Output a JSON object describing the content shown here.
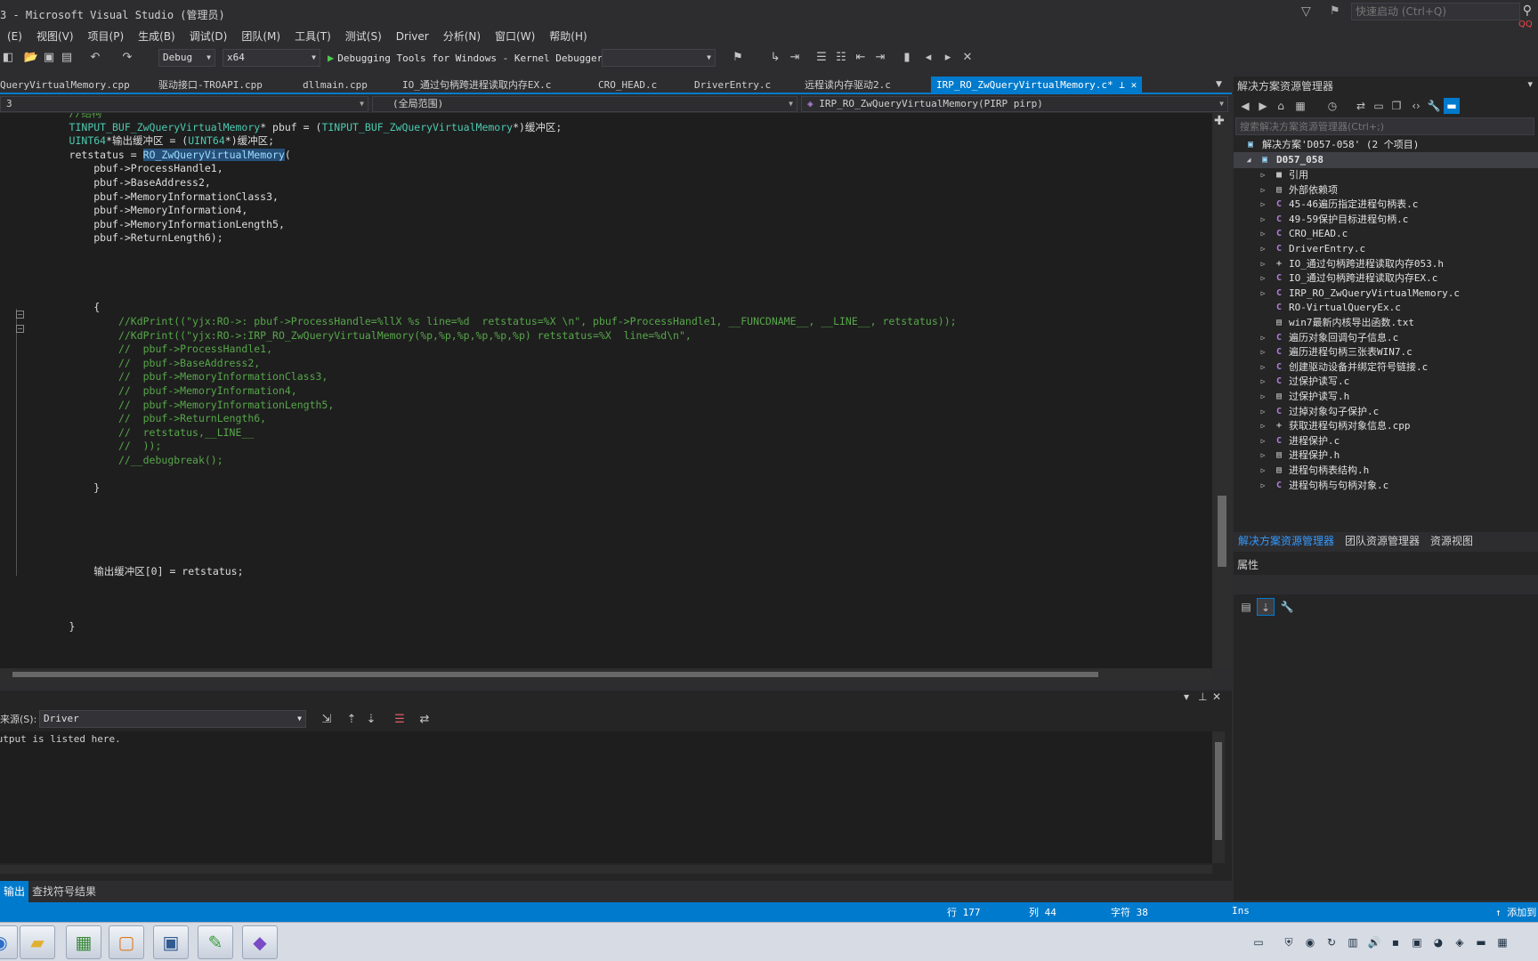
{
  "window": {
    "title": "3 - Microsoft Visual Studio (管理员)",
    "quick_launch_placeholder": "快速启动 (Ctrl+Q)",
    "badge": "QQ"
  },
  "menu": [
    "(E)",
    "视图(V)",
    "项目(P)",
    "生成(B)",
    "调试(D)",
    "团队(M)",
    "工具(T)",
    "测试(S)",
    "Driver",
    "分析(N)",
    "窗口(W)",
    "帮助(H)"
  ],
  "toolbar": {
    "config": "Debug",
    "platform": "x64",
    "debugger": "Debugging Tools for Windows - Kernel Debugger"
  },
  "tabs": [
    {
      "label": "QueryVirtualMemory.cpp",
      "active": false
    },
    {
      "label": "驱动接口-TROAPI.cpp",
      "active": false
    },
    {
      "label": "dllmain.cpp",
      "active": false
    },
    {
      "label": "IO_通过句柄跨进程读取内存EX.c",
      "active": false
    },
    {
      "label": "CRO_HEAD.c",
      "active": false
    },
    {
      "label": "DriverEntry.c",
      "active": false
    },
    {
      "label": "远程读内存驱动2.c",
      "active": false
    },
    {
      "label": "IRP_RO_ZwQueryVirtualMemory.c*",
      "active": true
    }
  ],
  "navbar": {
    "project": "3",
    "scope": "(全局范围)",
    "member": "IRP_RO_ZwQueryVirtualMemory(PIRP pirp)"
  },
  "code": {
    "lines": [
      {
        "indent": "      ",
        "parts": [
          {
            "t": "//结构",
            "c": "cmt"
          }
        ]
      },
      {
        "indent": "      ",
        "parts": [
          {
            "t": "TINPUT_BUF_ZwQueryVirtualMemory",
            "c": "type"
          },
          {
            "t": "* pbuf = (",
            "c": ""
          },
          {
            "t": "TINPUT_BUF_ZwQueryVirtualMemory",
            "c": "type"
          },
          {
            "t": "*)缓冲区;",
            "c": ""
          }
        ]
      },
      {
        "indent": "      ",
        "parts": [
          {
            "t": "UINT64",
            "c": "type"
          },
          {
            "t": "*输出缓冲区 = (",
            "c": ""
          },
          {
            "t": "UINT64",
            "c": "type"
          },
          {
            "t": "*)缓冲区;",
            "c": ""
          }
        ]
      },
      {
        "indent": "      ",
        "parts": [
          {
            "t": "retstatus = ",
            "c": ""
          },
          {
            "t": "RO_ZwQueryVirtualMemory",
            "c": "hl"
          },
          {
            "t": "(",
            "c": ""
          }
        ]
      },
      {
        "indent": "          ",
        "parts": [
          {
            "t": "pbuf->ProcessHandle1,",
            "c": ""
          }
        ]
      },
      {
        "indent": "          ",
        "parts": [
          {
            "t": "pbuf->BaseAddress2,",
            "c": ""
          }
        ]
      },
      {
        "indent": "          ",
        "parts": [
          {
            "t": "pbuf->MemoryInformationClass3,",
            "c": ""
          }
        ]
      },
      {
        "indent": "          ",
        "parts": [
          {
            "t": "pbuf->MemoryInformation4,",
            "c": ""
          }
        ]
      },
      {
        "indent": "          ",
        "parts": [
          {
            "t": "pbuf->MemoryInformationLength5,",
            "c": ""
          }
        ]
      },
      {
        "indent": "          ",
        "parts": [
          {
            "t": "pbuf->ReturnLength6);",
            "c": ""
          }
        ]
      },
      {
        "indent": "",
        "parts": []
      },
      {
        "indent": "",
        "parts": []
      },
      {
        "indent": "",
        "parts": []
      },
      {
        "indent": "",
        "parts": []
      },
      {
        "indent": "          ",
        "parts": [
          {
            "t": "{",
            "c": ""
          }
        ]
      },
      {
        "indent": "              ",
        "parts": [
          {
            "t": "//KdPrint((\"yjx:RO->: pbuf->ProcessHandle=%llX %s line=%d  retstatus=%X \\n\", pbuf->ProcessHandle1, __FUNCDNAME__, __LINE__, retstatus));",
            "c": "cmt"
          }
        ]
      },
      {
        "indent": "              ",
        "parts": [
          {
            "t": "//KdPrint((\"yjx:RO->:IRP_RO_ZwQueryVirtualMemory(%p,%p,%p,%p,%p,%p) retstatus=%X  line=%d\\n\",",
            "c": "cmt"
          }
        ]
      },
      {
        "indent": "              ",
        "parts": [
          {
            "t": "//  pbuf->ProcessHandle1,",
            "c": "cmt"
          }
        ]
      },
      {
        "indent": "              ",
        "parts": [
          {
            "t": "//  pbuf->BaseAddress2,",
            "c": "cmt"
          }
        ]
      },
      {
        "indent": "              ",
        "parts": [
          {
            "t": "//  pbuf->MemoryInformationClass3,",
            "c": "cmt"
          }
        ]
      },
      {
        "indent": "              ",
        "parts": [
          {
            "t": "//  pbuf->MemoryInformation4,",
            "c": "cmt"
          }
        ]
      },
      {
        "indent": "              ",
        "parts": [
          {
            "t": "//  pbuf->MemoryInformationLength5,",
            "c": "cmt"
          }
        ]
      },
      {
        "indent": "              ",
        "parts": [
          {
            "t": "//  pbuf->ReturnLength6,",
            "c": "cmt"
          }
        ]
      },
      {
        "indent": "              ",
        "parts": [
          {
            "t": "//  retstatus,__LINE__",
            "c": "cmt"
          }
        ]
      },
      {
        "indent": "              ",
        "parts": [
          {
            "t": "//  ));",
            "c": "cmt"
          }
        ]
      },
      {
        "indent": "              ",
        "parts": [
          {
            "t": "//__debugbreak();",
            "c": "cmt"
          }
        ]
      },
      {
        "indent": "",
        "parts": []
      },
      {
        "indent": "          ",
        "parts": [
          {
            "t": "}",
            "c": ""
          }
        ]
      },
      {
        "indent": "",
        "parts": []
      },
      {
        "indent": "",
        "parts": []
      },
      {
        "indent": "",
        "parts": []
      },
      {
        "indent": "",
        "parts": []
      },
      {
        "indent": "",
        "parts": []
      },
      {
        "indent": "          ",
        "parts": [
          {
            "t": "输出缓冲区[0] = retstatus;",
            "c": ""
          }
        ]
      },
      {
        "indent": "",
        "parts": []
      },
      {
        "indent": "",
        "parts": []
      },
      {
        "indent": "",
        "parts": []
      },
      {
        "indent": "      ",
        "parts": [
          {
            "t": "}",
            "c": ""
          }
        ]
      }
    ]
  },
  "output": {
    "source_label": "来源(S):",
    "source_value": "Driver",
    "text": "Output is listed here."
  },
  "bottom_tabs": [
    "输出",
    "查找符号结果"
  ],
  "status": {
    "line": "行 177",
    "col": "列 44",
    "char": "字符 38",
    "mode": "Ins",
    "publish": "添加到"
  },
  "solution_explorer": {
    "title": "解决方案资源管理器",
    "search_placeholder": "搜索解决方案资源管理器(Ctrl+;)",
    "solution": "解决方案'D057-058' (2 个项目)",
    "project": "D057_058",
    "items": [
      {
        "label": "引用",
        "icon": "■",
        "exp": true
      },
      {
        "label": "外部依赖项",
        "icon": "▤",
        "exp": true
      },
      {
        "label": "45-46遍历指定进程句柄表.c",
        "icon": "C",
        "exp": true
      },
      {
        "label": "49-59保护目标进程句柄.c",
        "icon": "C",
        "exp": true
      },
      {
        "label": "CRO_HEAD.c",
        "icon": "C",
        "exp": true
      },
      {
        "label": "DriverEntry.c",
        "icon": "C",
        "exp": true
      },
      {
        "label": "IO_通过句柄跨进程读取内存053.h",
        "icon": "+",
        "exp": true
      },
      {
        "label": "IO_通过句柄跨进程读取内存EX.c",
        "icon": "C",
        "exp": true
      },
      {
        "label": "IRP_RO_ZwQueryVirtualMemory.c",
        "icon": "C",
        "exp": true
      },
      {
        "label": "RO-VirtualQueryEx.c",
        "icon": "C",
        "exp": false
      },
      {
        "label": "win7最新内核导出函数.txt",
        "icon": "▤",
        "exp": false
      },
      {
        "label": "遍历对象回调句子信息.c",
        "icon": "C",
        "exp": true
      },
      {
        "label": "遍历进程句柄三张表WIN7.c",
        "icon": "C",
        "exp": true
      },
      {
        "label": "创建驱动设备并绑定符号链接.c",
        "icon": "C",
        "exp": true
      },
      {
        "label": "过保护读写.c",
        "icon": "C",
        "exp": true
      },
      {
        "label": "过保护读写.h",
        "icon": "▤",
        "exp": true
      },
      {
        "label": "过掉对象勾子保护.c",
        "icon": "C",
        "exp": true
      },
      {
        "label": "获取进程句柄对象信息.cpp",
        "icon": "+",
        "exp": true
      },
      {
        "label": "进程保护.c",
        "icon": "C",
        "exp": true
      },
      {
        "label": "进程保护.h",
        "icon": "▤",
        "exp": true
      },
      {
        "label": "进程句柄表结构.h",
        "icon": "▤",
        "exp": true
      },
      {
        "label": "进程句柄与句柄对象.c",
        "icon": "C",
        "exp": true
      }
    ],
    "bottom_tabs": [
      "解决方案资源管理器",
      "团队资源管理器",
      "资源视图"
    ]
  },
  "properties": {
    "title": "属性"
  },
  "colors": {
    "accent": "#007acc",
    "editor_bg": "#1e1e1e",
    "comment": "#57a64a",
    "type": "#4ec9b0"
  }
}
